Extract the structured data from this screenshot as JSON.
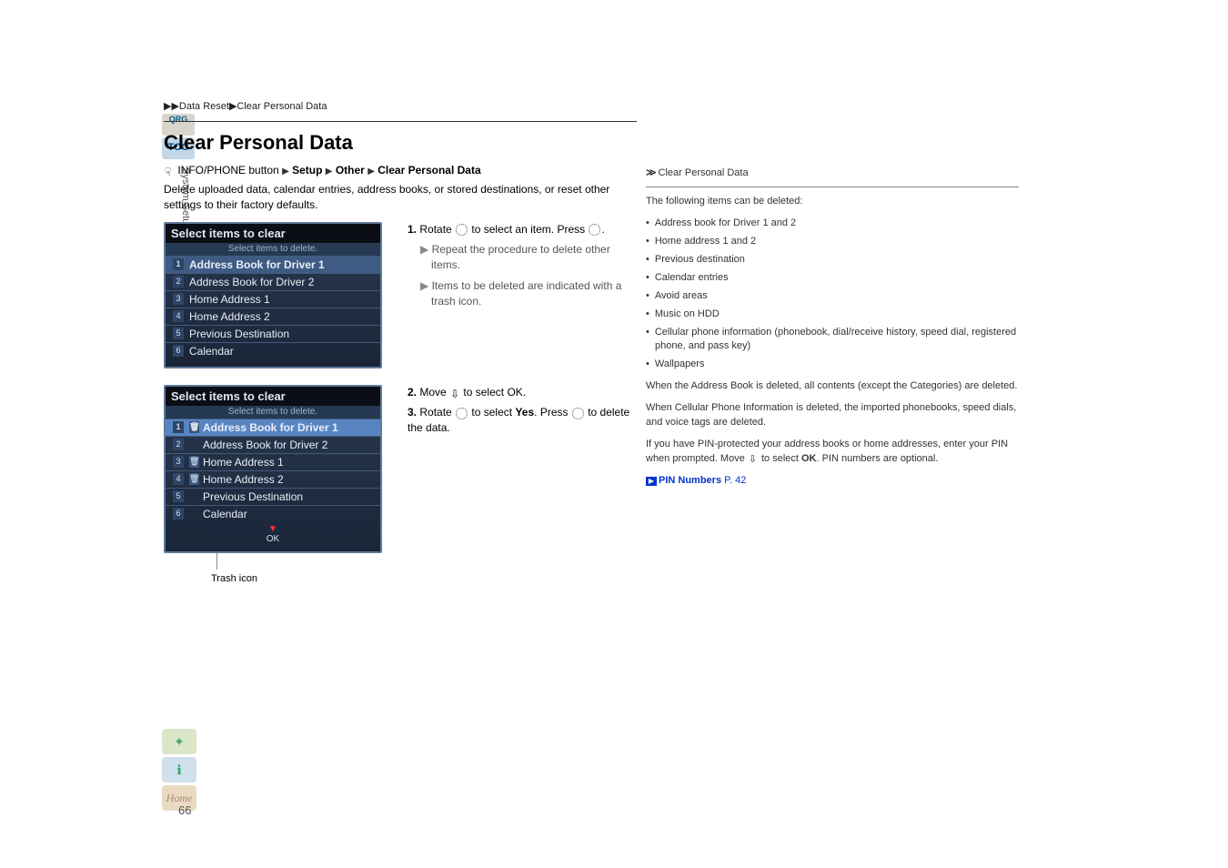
{
  "breadcrumb": "▶▶Data Reset▶Clear Personal Data",
  "title": "Clear Personal Data",
  "navline": {
    "pre": "INFO/PHONE button",
    "sep": "▶",
    "s1": "Setup",
    "s2": "Other",
    "s3": "Clear Personal Data"
  },
  "intro": "Delete uploaded data, calendar entries, address books, or stored destinations, or reset other settings to their factory defaults.",
  "shot1": {
    "header": "Select items to clear",
    "sub": "Select items to delete.",
    "items": [
      "Address Book for Driver 1",
      "Address Book for Driver 2",
      "Home Address 1",
      "Home Address 2",
      "Previous Destination",
      "Calendar"
    ]
  },
  "shot2": {
    "header": "Select items to clear",
    "sub": "Select items to delete.",
    "items": [
      "Address Book for Driver 1",
      "Address Book for Driver 2",
      "Home Address 1",
      "Home Address 2",
      "Previous Destination",
      "Calendar"
    ],
    "ok": "OK"
  },
  "trash_label": "Trash icon",
  "step1": {
    "num": "1.",
    "pre": "Rotate",
    "post": "to select an item. Press",
    "sub1_pre": "▶",
    "sub1": "Repeat the procedure to delete other items.",
    "sub2_pre": "▶",
    "sub2": "Items to be deleted are indicated with a trash icon."
  },
  "step2": {
    "num": "2.",
    "pre": "Move",
    "post": "to select",
    "ok": "OK",
    "end": "."
  },
  "step3": {
    "num": "3.",
    "pre": "Rotate",
    "mid": "to select",
    "yes": "Yes",
    "mid2": ". Press",
    "end": "to delete the data."
  },
  "side": {
    "hdr": "Clear Personal Data",
    "intro": "The following items can be deleted:",
    "bullets": [
      "Address book for Driver 1 and 2",
      "Home address 1 and 2",
      "Previous destination",
      "Calendar entries",
      "Avoid areas",
      "Music on HDD",
      "Cellular phone information (phonebook, dial/receive history, speed dial, registered phone, and pass key)",
      "Wallpapers"
    ],
    "p1": "When the Address Book is deleted, all contents (except the Categories) are deleted.",
    "p2": "When Cellular Phone Information is deleted, the imported phonebooks, speed dials, and voice tags are deleted.",
    "p3a": "If you have PIN-protected your address books or home addresses, enter your PIN when prompted. Move",
    "p3b": "to select",
    "p3c": "OK",
    "p3d": ". PIN numbers are optional.",
    "link": "PIN Numbers",
    "linkpage": "P. 42"
  },
  "tabs": {
    "qrg": "QRG",
    "toc": "TOC"
  },
  "vlabel": "System Setup",
  "home": "Home",
  "pagenum": "66"
}
